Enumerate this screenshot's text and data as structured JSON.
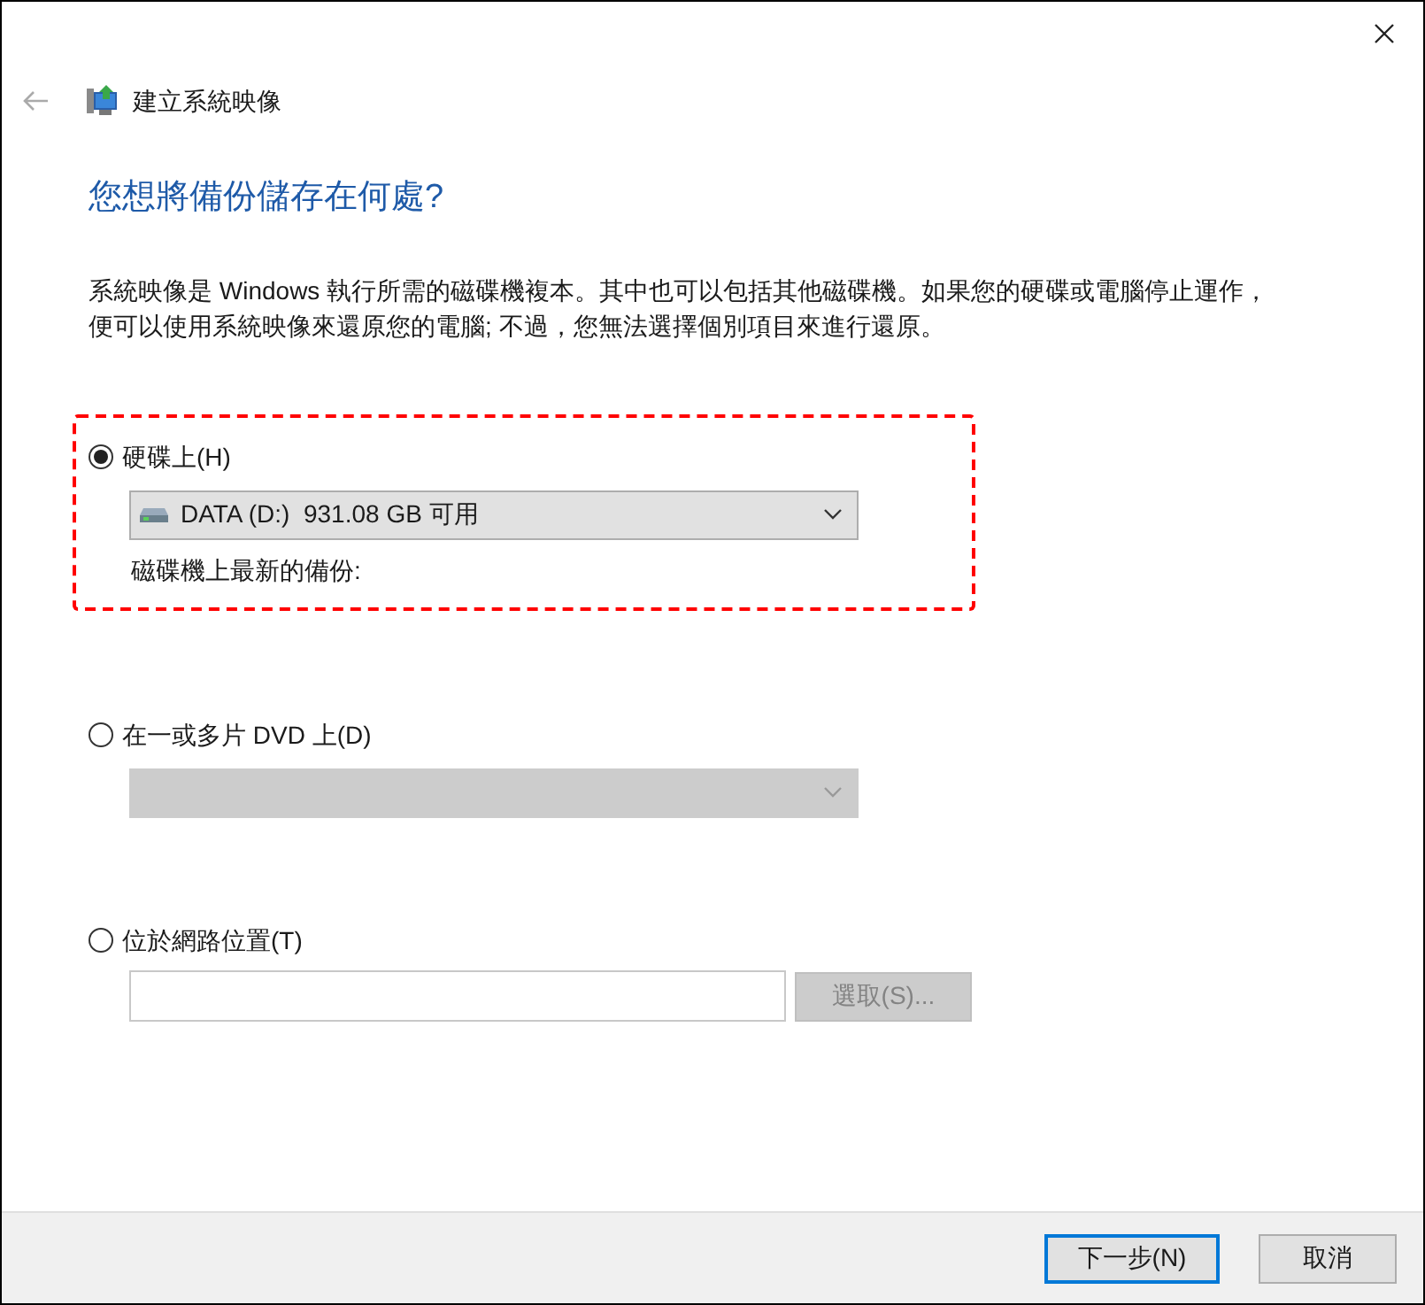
{
  "window": {
    "title": "建立系統映像"
  },
  "heading": "您想將備份儲存在何處?",
  "description": "系統映像是 Windows 執行所需的磁碟機複本。其中也可以包括其他磁碟機。如果您的硬碟或電腦停止運作，便可以使用系統映像來還原您的電腦; 不過，您無法選擇個別項目來進行還原。",
  "options": [
    {
      "kind": "dropdown",
      "label": "硬碟上(H)",
      "selected": true,
      "highlighted": true,
      "dropdown": {
        "value": "DATA (D:)  931.08 GB 可用",
        "disabled": false
      },
      "caption": "磁碟機上最新的備份:"
    },
    {
      "kind": "dropdown",
      "label": "在一或多片 DVD 上(D)",
      "selected": false,
      "highlighted": false,
      "dropdown": {
        "disabled": true
      }
    },
    {
      "kind": "path",
      "label": "位於網路位置(T)",
      "selected": false,
      "highlighted": false,
      "button": {
        "label": "選取(S)...",
        "disabled": true
      }
    }
  ],
  "buttons": [
    {
      "label": "下一步(N)",
      "default": true
    },
    {
      "label": "取消",
      "default": false
    }
  ]
}
